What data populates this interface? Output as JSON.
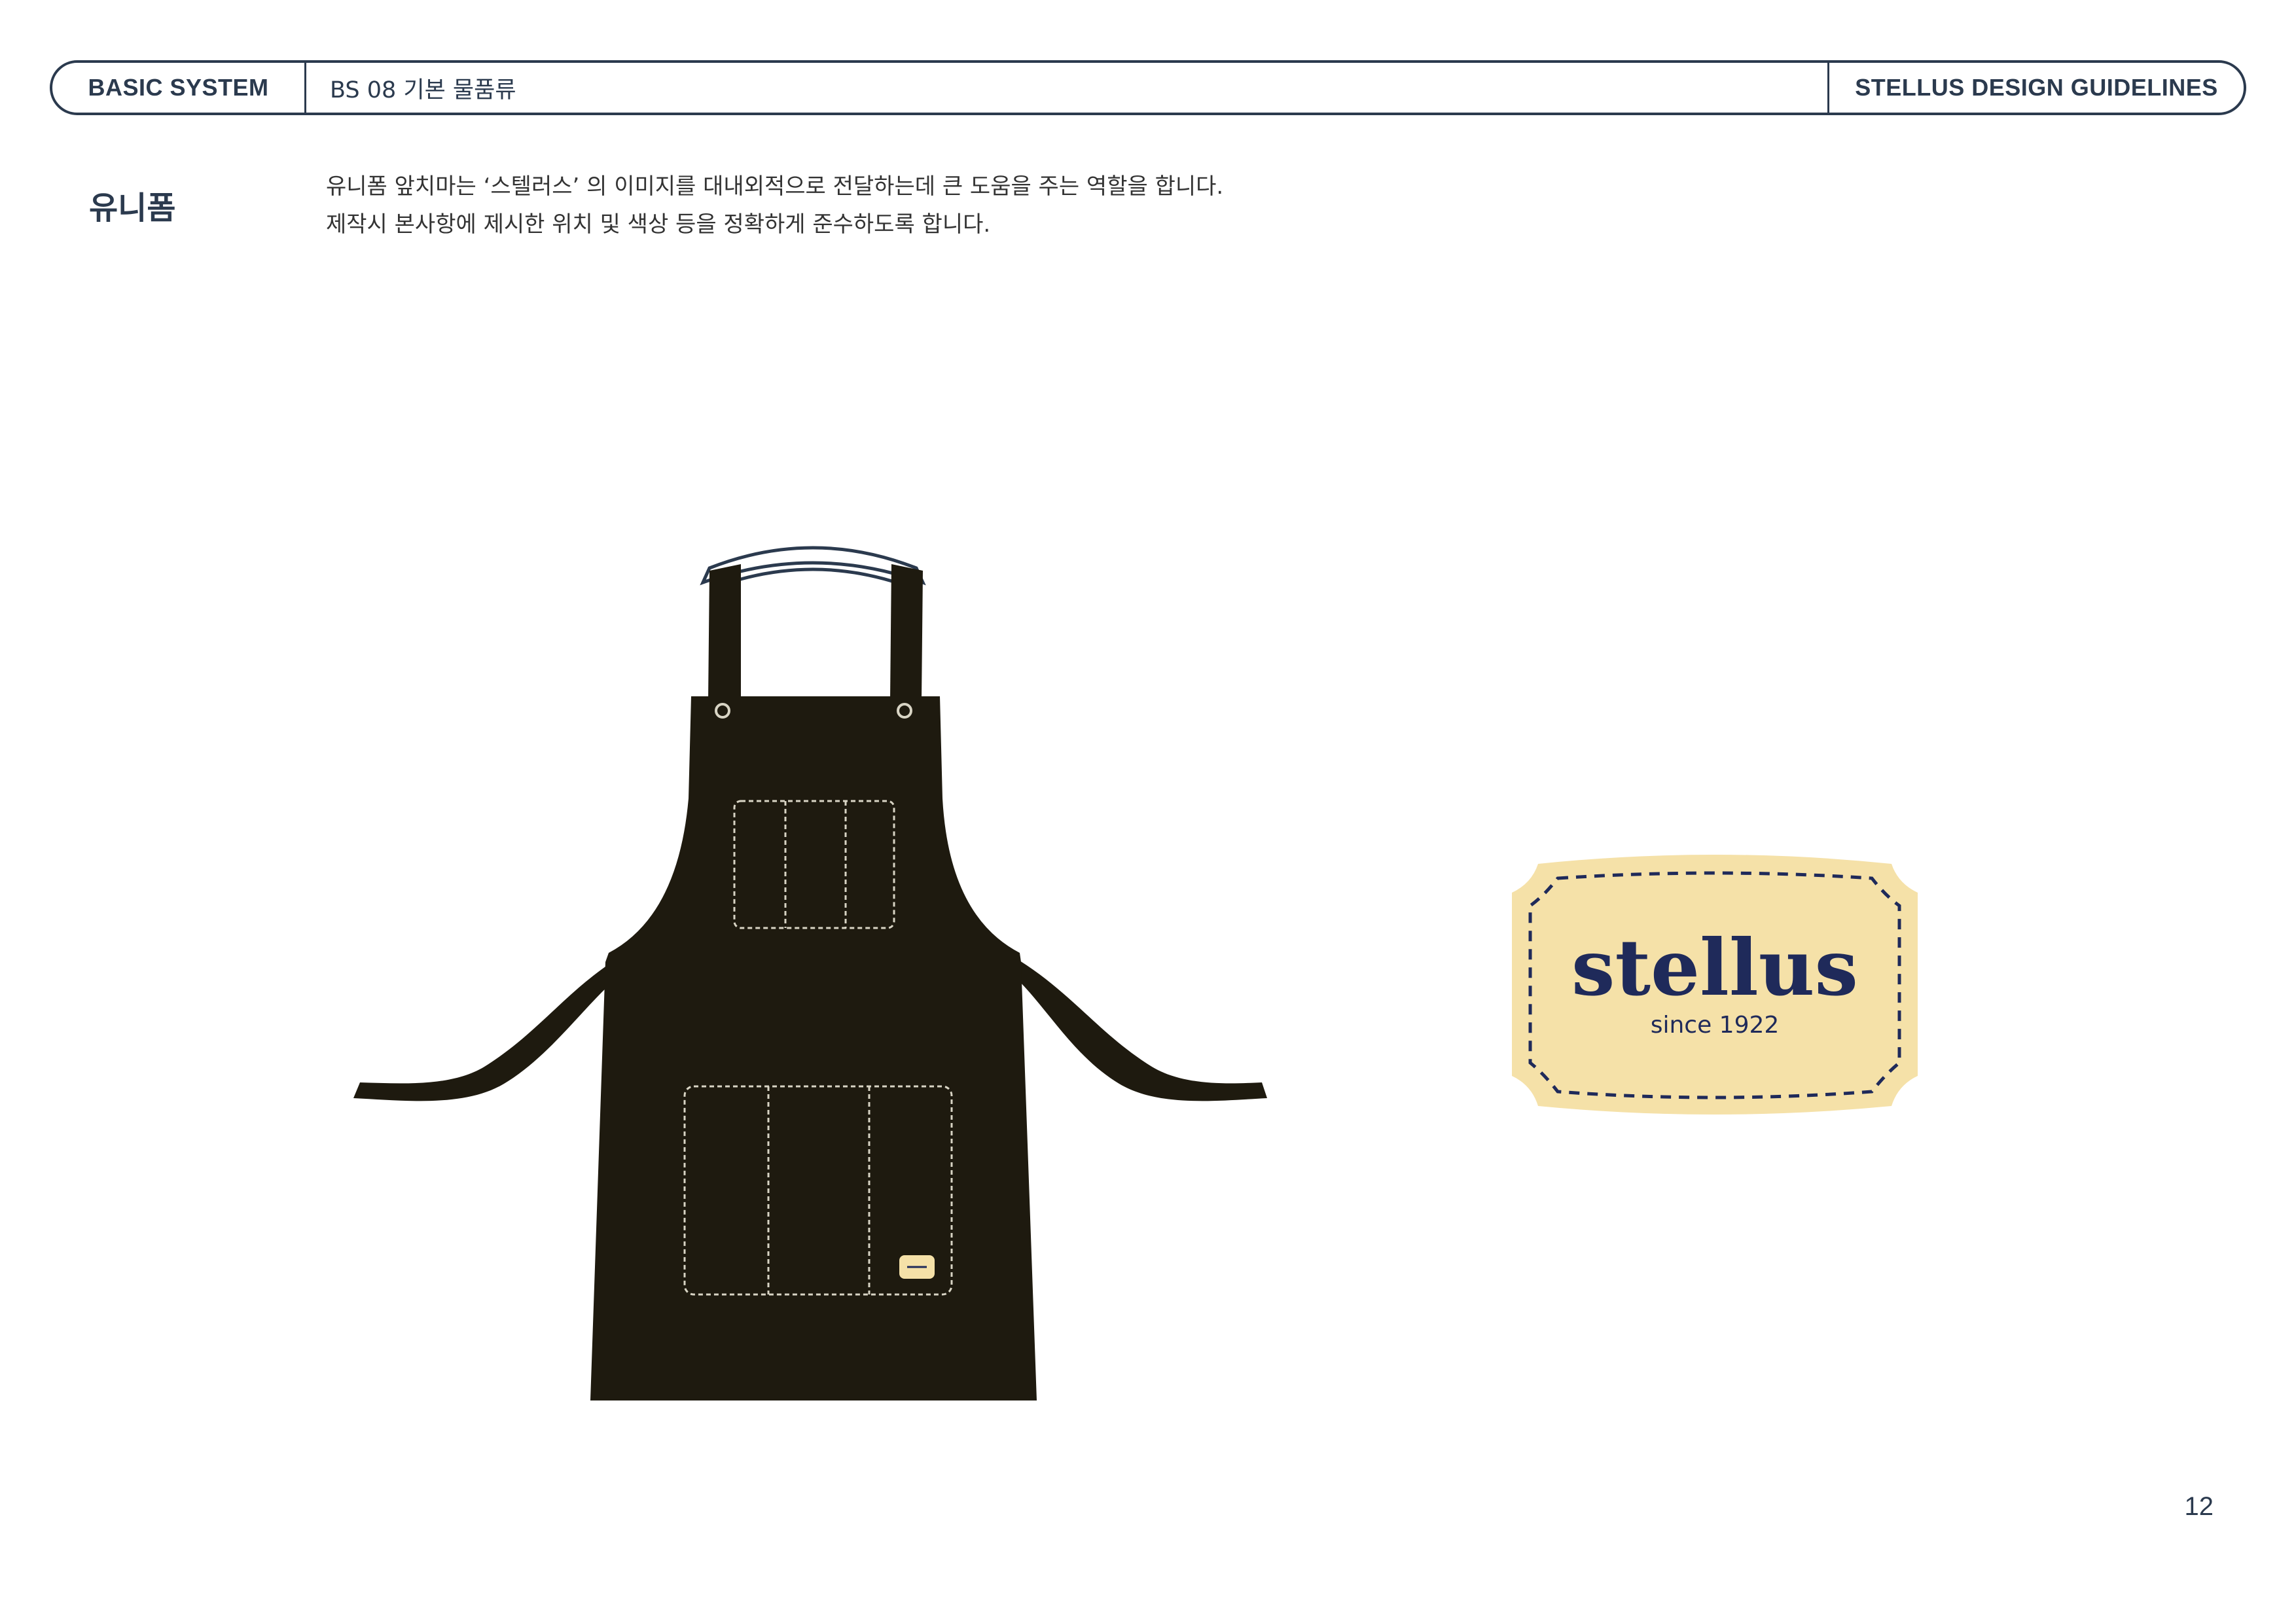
{
  "header": {
    "section": "BASIC SYSTEM",
    "subsection": "BS 08  기본 물품류",
    "guide_title": "STELLUS DESIGN GUIDELINES"
  },
  "page": {
    "title": "유니폼",
    "description": [
      "유니폼 앞치마는 ‘스텔러스’ 의 이미지를 대내외적으로 전달하는데 큰 도움을 주는 역할을 합니다.",
      "제작시 본사항에 제시한 위치 및 색상 등을 정확하게 준수하도록 합니다."
    ],
    "page_number": "12"
  },
  "badge": {
    "brand": "stellus",
    "tagline": "since 1922"
  },
  "colors": {
    "navy": "#2b3a4e",
    "apron": "#1e1a0f",
    "badge_fill": "#f5e1a8",
    "badge_text": "#1f2a5a"
  }
}
